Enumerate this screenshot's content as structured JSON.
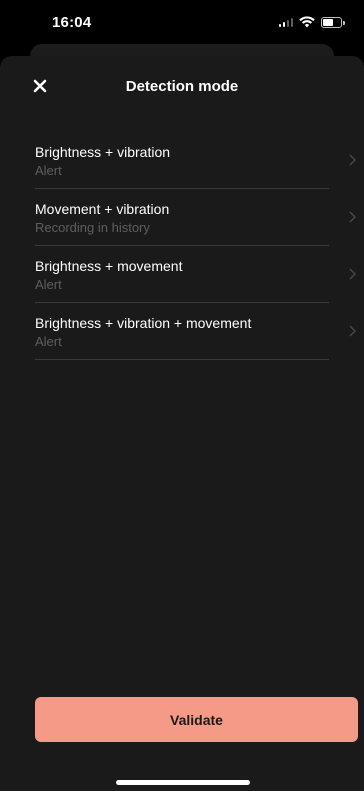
{
  "status_bar": {
    "time": "16:04"
  },
  "sheet": {
    "title": "Detection mode",
    "close_icon": "close-icon"
  },
  "options": [
    {
      "title": "Brightness + vibration",
      "subtitle": "Alert"
    },
    {
      "title": "Movement + vibration",
      "subtitle": "Recording in history"
    },
    {
      "title": "Brightness + movement",
      "subtitle": "Alert"
    },
    {
      "title": "Brightness + vibration + movement",
      "subtitle": "Alert"
    }
  ],
  "footer": {
    "validate_label": "Validate"
  },
  "colors": {
    "background": "#000000",
    "sheet": "#1a1a1a",
    "accent": "#f59a87",
    "divider": "#3a3a3a",
    "subtitle": "#5e5e5e"
  }
}
